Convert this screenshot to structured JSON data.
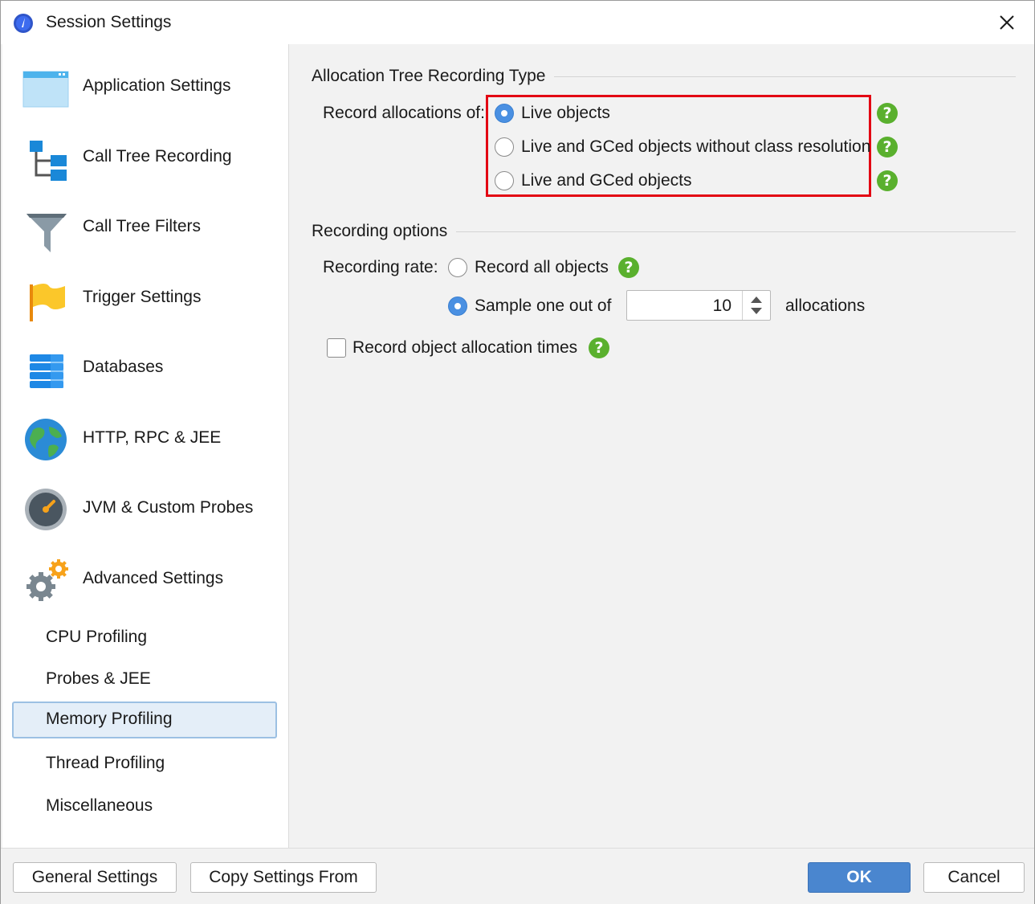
{
  "window": {
    "title": "Session Settings"
  },
  "sidebar": {
    "items": [
      {
        "label": "Application Settings",
        "icon": "window-icon"
      },
      {
        "label": "Call Tree Recording",
        "icon": "tree-icon"
      },
      {
        "label": "Call Tree Filters",
        "icon": "funnel-icon"
      },
      {
        "label": "Trigger Settings",
        "icon": "flag-icon"
      },
      {
        "label": "Databases",
        "icon": "database-icon"
      },
      {
        "label": "HTTP, RPC & JEE",
        "icon": "globe-icon"
      },
      {
        "label": "JVM & Custom Probes",
        "icon": "gauge-icon"
      },
      {
        "label": "Advanced Settings",
        "icon": "gears-icon"
      }
    ],
    "sub_items": [
      {
        "label": "CPU Profiling",
        "selected": false
      },
      {
        "label": "Probes & JEE",
        "selected": false
      },
      {
        "label": "Memory Profiling",
        "selected": true
      },
      {
        "label": "Thread Profiling",
        "selected": false
      },
      {
        "label": "Miscellaneous",
        "selected": false
      }
    ]
  },
  "allocation_section": {
    "title": "Allocation Tree Recording Type",
    "record_label": "Record allocations of:",
    "options": [
      {
        "label": "Live objects",
        "checked": true
      },
      {
        "label": "Live and GCed objects without class resolution",
        "checked": false
      },
      {
        "label": "Live and GCed objects",
        "checked": false
      }
    ],
    "help_glyph": "?"
  },
  "recording_section": {
    "title": "Recording options",
    "rate_label": "Recording rate:",
    "record_all_label": "Record all objects",
    "record_all_checked": false,
    "sample_label": "Sample one out of",
    "sample_checked": true,
    "sample_value": "10",
    "sample_suffix": "allocations",
    "record_times_label": "Record object allocation times",
    "record_times_checked": false
  },
  "buttons": {
    "general_settings": "General Settings",
    "copy_settings": "Copy Settings From",
    "ok": "OK",
    "cancel": "Cancel"
  },
  "colors": {
    "accent": "#4a86cf",
    "highlight": "#e30613",
    "help": "#5ab02e",
    "selected_bg": "#e4eef8"
  }
}
